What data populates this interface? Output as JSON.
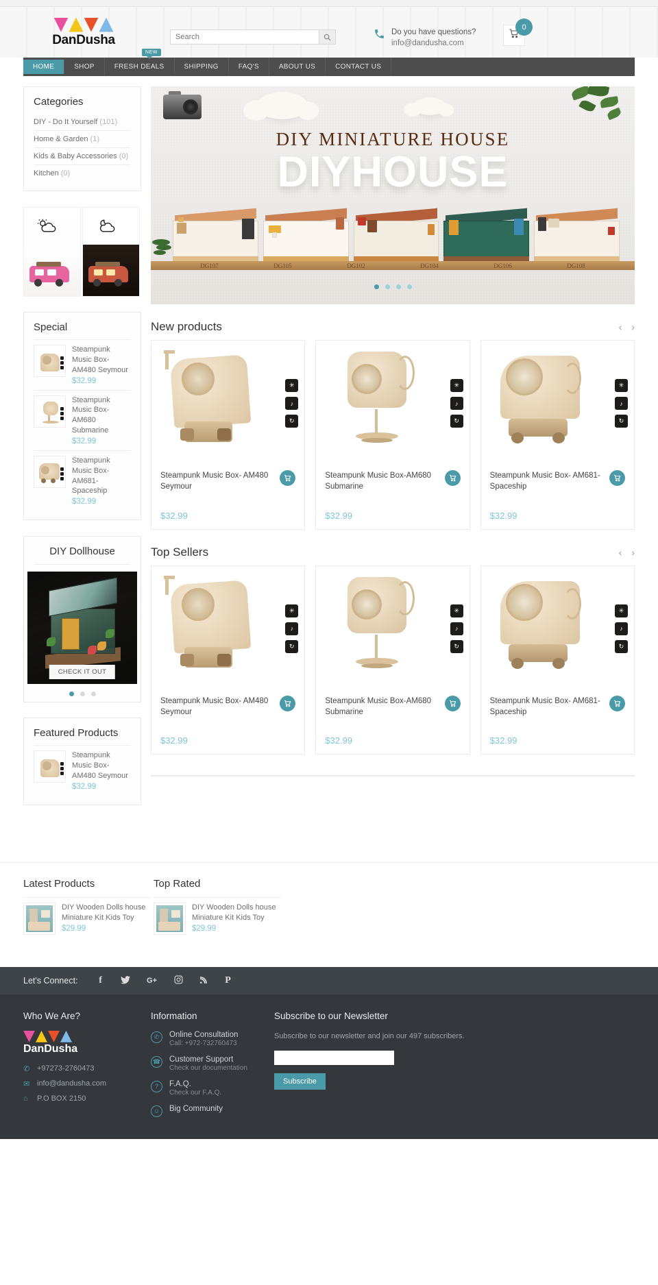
{
  "header": {
    "logo_text": "DanDusha",
    "logo_colors": [
      "#e8509e",
      "#f5c518",
      "#e8502a",
      "#7fb9e8"
    ],
    "search": {
      "placeholder": "Search",
      "value": "",
      "icon": "search-icon"
    },
    "support": {
      "question": "Do you have questions?",
      "email": "info@dandusha.com",
      "icon": "phone-icon"
    },
    "cart": {
      "count": "0",
      "icon": "cart-icon"
    }
  },
  "nav": {
    "badge": "NEW",
    "items": [
      {
        "label": "HOME",
        "active": true
      },
      {
        "label": "SHOP",
        "active": false
      },
      {
        "label": "FRESH DEALS",
        "active": false
      },
      {
        "label": "SHIPPING",
        "active": false
      },
      {
        "label": "FAQ'S",
        "active": false
      },
      {
        "label": "ABOUT US",
        "active": false
      },
      {
        "label": "CONTACT US",
        "active": false
      }
    ]
  },
  "sidebar": {
    "categories": {
      "title": "Categories",
      "items": [
        {
          "label": "DIY - Do It Yourself",
          "count": "(101)"
        },
        {
          "label": "Home & Garden",
          "count": "(1)"
        },
        {
          "label": "Kids & Baby Accessories",
          "count": "(0)"
        },
        {
          "label": "Kitchen",
          "count": "(0)"
        }
      ]
    },
    "special": {
      "title": "Special",
      "items": [
        {
          "name": "Steampunk Music Box- AM480 Seymour",
          "price": "$32.99"
        },
        {
          "name": "Steampunk Music Box-AM680 Submarine",
          "price": "$32.99"
        },
        {
          "name": "Steampunk Music Box- AM681-Spaceship",
          "price": "$32.99"
        }
      ]
    },
    "dollhouse": {
      "title": "DIY Dollhouse",
      "cta": "CHECK IT OUT",
      "dots": 3,
      "active_dot": 0
    },
    "featured": {
      "title": "Featured Products",
      "items": [
        {
          "name": "Steampunk Music Box- AM480 Seymour",
          "price": "$32.99"
        }
      ]
    }
  },
  "banner": {
    "headline": "DIY MINIATURE HOUSE",
    "subheadline": "DIYHOUSE",
    "shelf_labels": [
      "DG107",
      "DG105",
      "DG102",
      "DG104",
      "DG106",
      "DG108"
    ],
    "dots": 4,
    "active_dot": 0,
    "accent": "#4a9aa8"
  },
  "sections": [
    {
      "title": "New products",
      "prev": "‹",
      "next": "›",
      "products": [
        {
          "name": "Steampunk Music Box- AM480 Seymour",
          "price": "$32.99",
          "cart_icon": "cart-icon",
          "badges": [
            "laser-cutting-icon",
            "music-icon",
            "rotation-icon"
          ]
        },
        {
          "name": "Steampunk Music Box-AM680 Submarine",
          "price": "$32.99",
          "cart_icon": "cart-icon",
          "badges": [
            "laser-cutting-icon",
            "music-icon",
            "rotation-icon"
          ]
        },
        {
          "name": "Steampunk Music Box- AM681-Spaceship",
          "price": "$32.99",
          "cart_icon": "cart-icon",
          "badges": [
            "laser-cutting-icon",
            "music-icon",
            "rotation-icon"
          ]
        }
      ]
    },
    {
      "title": "Top Sellers",
      "prev": "‹",
      "next": "›",
      "products": [
        {
          "name": "Steampunk Music Box- AM480 Seymour",
          "price": "$32.99",
          "cart_icon": "cart-icon",
          "badges": [
            "laser-cutting-icon",
            "music-icon",
            "rotation-icon"
          ]
        },
        {
          "name": "Steampunk Music Box-AM680 Submarine",
          "price": "$32.99",
          "cart_icon": "cart-icon",
          "badges": [
            "laser-cutting-icon",
            "music-icon",
            "rotation-icon"
          ]
        },
        {
          "name": "Steampunk Music Box- AM681-Spaceship",
          "price": "$32.99",
          "cart_icon": "cart-icon",
          "badges": [
            "laser-cutting-icon",
            "music-icon",
            "rotation-icon"
          ]
        }
      ]
    }
  ],
  "bottom_lists": [
    {
      "title": "Latest Products",
      "items": [
        {
          "name": "DIY Wooden Dolls house Miniature Kit Kids Toy",
          "price": "$29.99"
        }
      ]
    },
    {
      "title": "Top Rated",
      "items": [
        {
          "name": "DIY Wooden Dolls house Miniature Kit Kids Toy",
          "price": "$29.99"
        }
      ]
    }
  ],
  "social": {
    "label": "Let's Connect:",
    "icons": [
      {
        "name": "facebook-icon",
        "glyph": "f"
      },
      {
        "name": "twitter-icon",
        "glyph": "✒"
      },
      {
        "name": "google-plus-icon",
        "glyph": "G+"
      },
      {
        "name": "instagram-icon",
        "glyph": "▣"
      },
      {
        "name": "rss-icon",
        "glyph": "◔"
      },
      {
        "name": "pinterest-icon",
        "glyph": "P"
      }
    ]
  },
  "footer": {
    "who": {
      "title": "Who We Are?",
      "logo_text": "DanDusha",
      "phone": "+97273-2760473",
      "email": "info@dandusha.com",
      "address": "P.O BOX 2150",
      "phone_icon": "phone-icon",
      "email_icon": "envelope-icon",
      "address_icon": "location-icon"
    },
    "information": {
      "title": "Information",
      "links": [
        {
          "title": "Online Consultation",
          "sub": "Call: +972-732760473",
          "icon": "phone-icon"
        },
        {
          "title": "Customer Support",
          "sub": "Check our documentation",
          "icon": "support-icon"
        },
        {
          "title": "F.A.Q.",
          "sub": "Check our F.A.Q.",
          "icon": "question-icon"
        },
        {
          "title": "Big Community",
          "sub": "",
          "icon": "community-icon"
        }
      ]
    },
    "newsletter": {
      "title": "Subscribe to our Newsletter",
      "description": "Subscribe to our newsletter and join our 497 subscribers.",
      "placeholder": "",
      "value": "",
      "button": "Subscribe"
    }
  }
}
